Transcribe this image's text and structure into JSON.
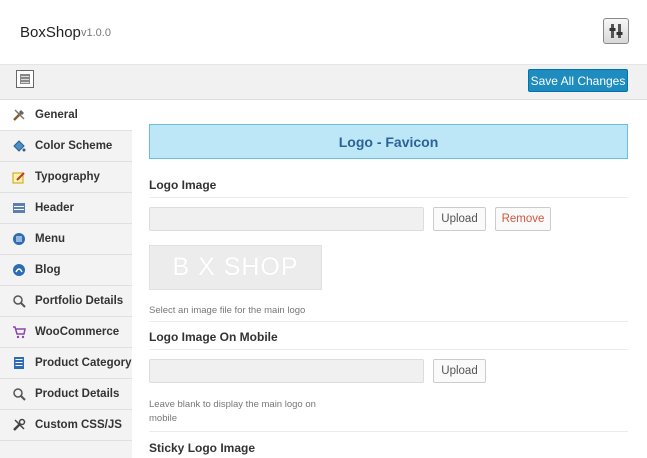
{
  "header": {
    "brand": "BoxShop",
    "version": "v1.0.0",
    "tools_icon": "tools-icon"
  },
  "toolbar": {
    "save_label": "Save All Changes",
    "collapse_icon": "collapse-icon"
  },
  "sidebar": {
    "items": [
      {
        "label": "General",
        "icon": "tools-icon",
        "active": true
      },
      {
        "label": "Color Scheme",
        "icon": "paint-bucket-icon"
      },
      {
        "label": "Typography",
        "icon": "pencil-icon"
      },
      {
        "label": "Header",
        "icon": "header-icon"
      },
      {
        "label": "Menu",
        "icon": "menu-icon"
      },
      {
        "label": "Blog",
        "icon": "blog-icon"
      },
      {
        "label": "Portfolio Details",
        "icon": "magnifier-icon"
      },
      {
        "label": "WooCommerce",
        "icon": "cart-icon"
      },
      {
        "label": "Product Category",
        "icon": "list-icon"
      },
      {
        "label": "Product Details",
        "icon": "magnifier-icon"
      },
      {
        "label": "Custom CSS/JS",
        "icon": "wrench-icon"
      }
    ]
  },
  "main": {
    "section_title": "Logo - Favicon",
    "logo": {
      "title": "Logo Image",
      "upload_label": "Upload",
      "remove_label": "Remove",
      "preview_text": "B  X SHOP",
      "description": "Select an image file for the main logo"
    },
    "logo_mobile": {
      "title": "Logo Image On Mobile",
      "upload_label": "Upload",
      "description_line1": "Leave blank to display the main logo on",
      "description_line2": "mobile"
    },
    "sticky_logo": {
      "title": "Sticky Logo Image"
    }
  },
  "colors": {
    "accent": "#1e8cbe",
    "banner_bg": "#bde7f7",
    "banner_text": "#2a6496",
    "remove_text": "#d0573b"
  }
}
